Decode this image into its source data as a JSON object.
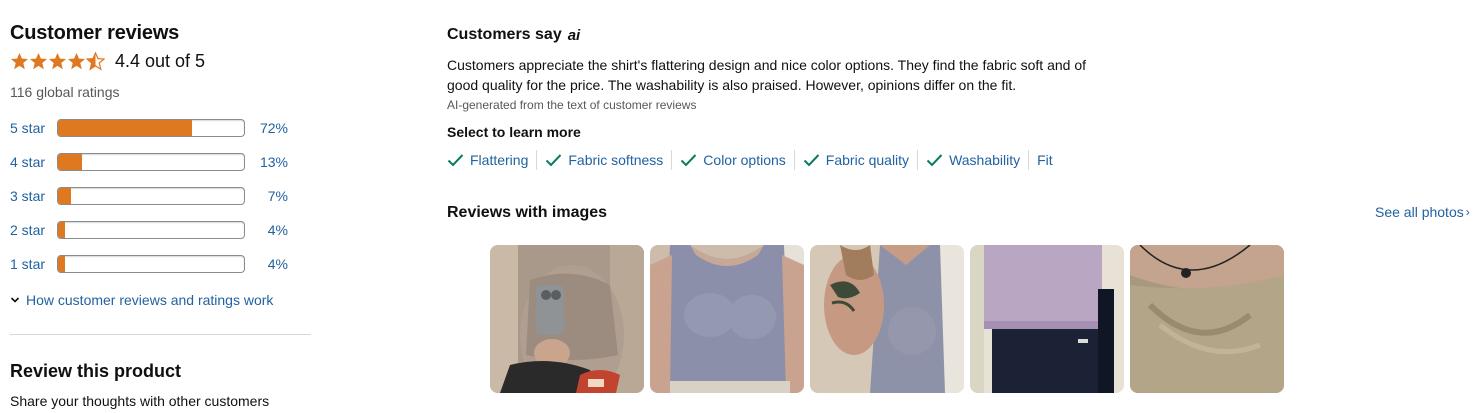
{
  "summary": {
    "title": "Customer reviews",
    "rating_text": "4.4 out of 5",
    "rating_value": 4.4,
    "global_ratings": "116 global ratings",
    "star_color": "#de7921"
  },
  "histogram": [
    {
      "label": "5 star",
      "pct": "72%",
      "fraction": 0.72
    },
    {
      "label": "4 star",
      "pct": "13%",
      "fraction": 0.13
    },
    {
      "label": "3 star",
      "pct": "7%",
      "fraction": 0.07
    },
    {
      "label": "2 star",
      "pct": "4%",
      "fraction": 0.04
    },
    {
      "label": "1 star",
      "pct": "4%",
      "fraction": 0.04
    }
  ],
  "how_link": "How customer reviews and ratings work",
  "review_product": {
    "title": "Review this product",
    "subtitle": "Share your thoughts with other customers"
  },
  "customers_say": {
    "title": "Customers say",
    "ai_badge": "ai",
    "text": "Customers appreciate the shirt's flattering design and nice color options. They find the fabric soft and of good quality for the price. The washability is also praised. However, opinions differ on the fit.",
    "ai_note": "AI-generated from the text of customer reviews",
    "select_label": "Select to learn more",
    "aspects": [
      {
        "label": "Flattering",
        "checked": true
      },
      {
        "label": "Fabric softness",
        "checked": true
      },
      {
        "label": "Color options",
        "checked": true
      },
      {
        "label": "Fabric quality",
        "checked": true
      },
      {
        "label": "Washability",
        "checked": true
      },
      {
        "label": "Fit",
        "checked": false
      }
    ]
  },
  "reviews_with_images": {
    "title": "Reviews with images",
    "see_all": "See all photos",
    "photos": [
      {
        "name": "mirror-selfie-taupe-top"
      },
      {
        "name": "blue-gray-tank-front"
      },
      {
        "name": "gray-tank-side-tattoo"
      },
      {
        "name": "lilac-and-navy-folded"
      },
      {
        "name": "beige-top-closeup"
      }
    ]
  },
  "colors": {
    "link": "#2162a1",
    "accent": "#de7921",
    "check": "#067d62"
  }
}
